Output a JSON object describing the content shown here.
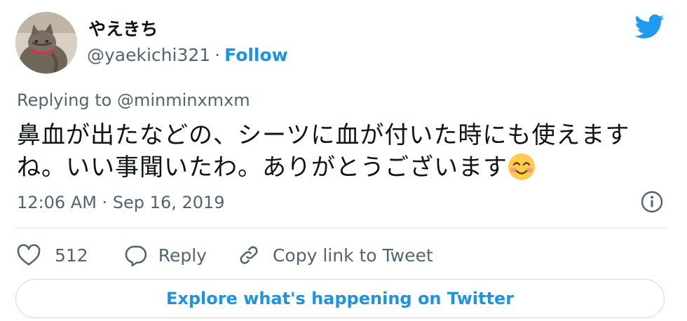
{
  "author": {
    "display_name": "やえきち",
    "handle": "@yaekichi321",
    "separator": "·",
    "follow_label": "Follow",
    "avatar": "cat-photo"
  },
  "brand": {
    "icon": "twitter-bird-icon",
    "color": "#1d9bf0"
  },
  "tweet": {
    "replying_prefix": "Replying to",
    "replying_to": "@minminxmxm",
    "text": "鼻血が出たなどの、シーツに血が付いた時にも使えますね。いい事聞いたわ。ありがとうございます",
    "emoji": "smiling-face-with-smiling-eyes",
    "timestamp": "12:06 AM · Sep 16, 2019"
  },
  "actions": {
    "like_count": "512",
    "reply_label": "Reply",
    "copy_label": "Copy link to Tweet"
  },
  "explore_label": "Explore what's happening on Twitter",
  "colors": {
    "accent": "#1b95e0",
    "secondary_text": "#536471",
    "primary_text": "#0f1419",
    "border": "#cfd9de"
  }
}
